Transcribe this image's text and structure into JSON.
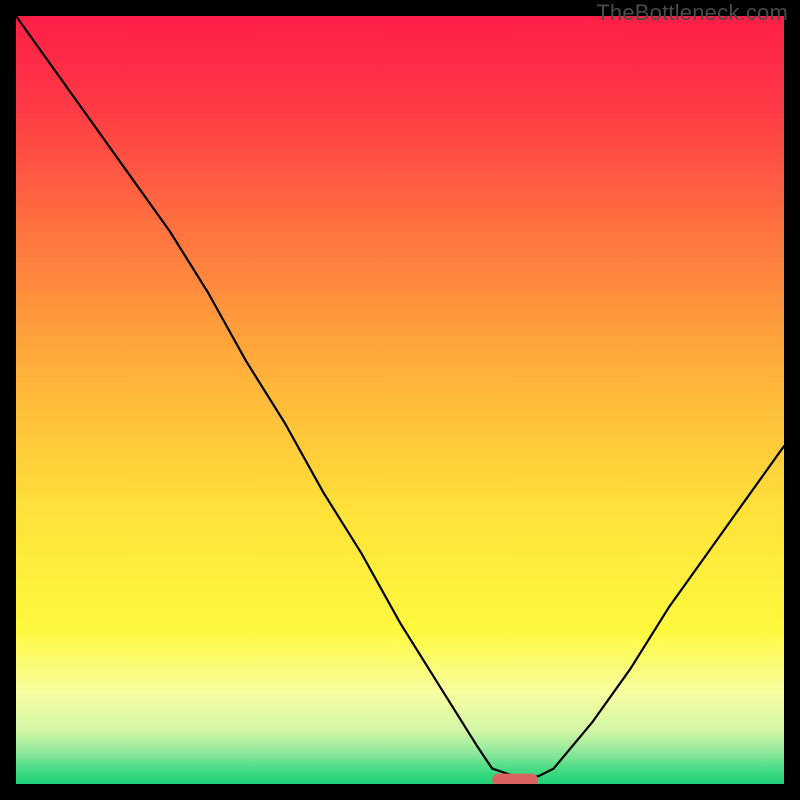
{
  "watermark": "TheBottleneck.com",
  "chart_data": {
    "type": "line",
    "title": "",
    "xlabel": "",
    "ylabel": "",
    "xlim": [
      0,
      100
    ],
    "ylim": [
      0,
      100
    ],
    "series": [
      {
        "name": "bottleneck-curve",
        "x": [
          0,
          5,
          10,
          15,
          20,
          25,
          30,
          35,
          40,
          45,
          50,
          55,
          60,
          62,
          65,
          68,
          70,
          75,
          80,
          85,
          90,
          95,
          100
        ],
        "values": [
          100,
          93,
          86,
          79,
          72,
          64,
          55,
          47,
          38,
          30,
          21,
          13,
          5,
          2,
          1,
          1,
          2,
          8,
          15,
          23,
          30,
          37,
          44
        ]
      }
    ],
    "marker": {
      "x_start": 62,
      "x_end": 68,
      "y": 0.5,
      "color": "#d9635f"
    },
    "gradient_stops": [
      {
        "offset": 0.0,
        "color": "#ff1e47"
      },
      {
        "offset": 0.12,
        "color": "#ff3a45"
      },
      {
        "offset": 0.3,
        "color": "#ff7a3e"
      },
      {
        "offset": 0.48,
        "color": "#ffb63a"
      },
      {
        "offset": 0.65,
        "color": "#ffe33a"
      },
      {
        "offset": 0.8,
        "color": "#fff93d"
      },
      {
        "offset": 0.88,
        "color": "#f7ffa0"
      },
      {
        "offset": 0.93,
        "color": "#d4f7a6"
      },
      {
        "offset": 0.96,
        "color": "#8be89a"
      },
      {
        "offset": 0.985,
        "color": "#3bd981"
      },
      {
        "offset": 1.0,
        "color": "#1fcf77"
      }
    ]
  }
}
